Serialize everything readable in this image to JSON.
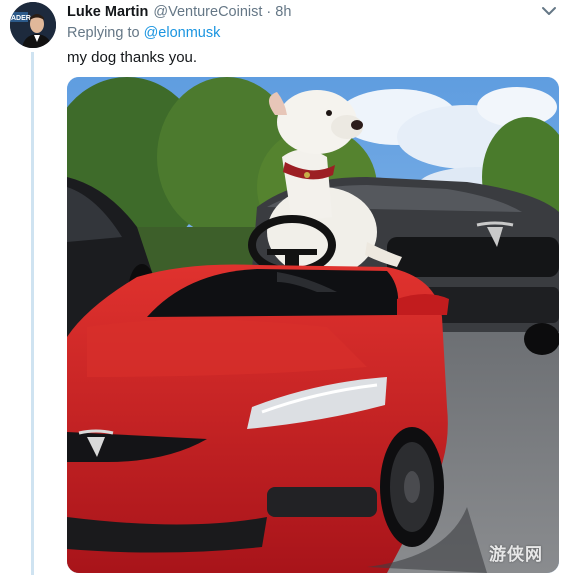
{
  "tweet": {
    "author_name": "Luke Martin",
    "author_handle": "@VentureCoinist",
    "separator": "·",
    "timestamp": "8h",
    "reply_prefix": "Replying to",
    "reply_handle": "@elonmusk",
    "text": "my dog thanks you."
  },
  "avatar": {
    "badge_text": "ADER"
  },
  "media": {
    "description_icon": "photo",
    "watermark": "游侠网"
  },
  "icons": {
    "caret": "chevron-down-icon"
  },
  "colors": {
    "name": "#14171a",
    "secondary": "#657786",
    "link": "#1b95e0",
    "thread_line": "#cfe3f1"
  }
}
